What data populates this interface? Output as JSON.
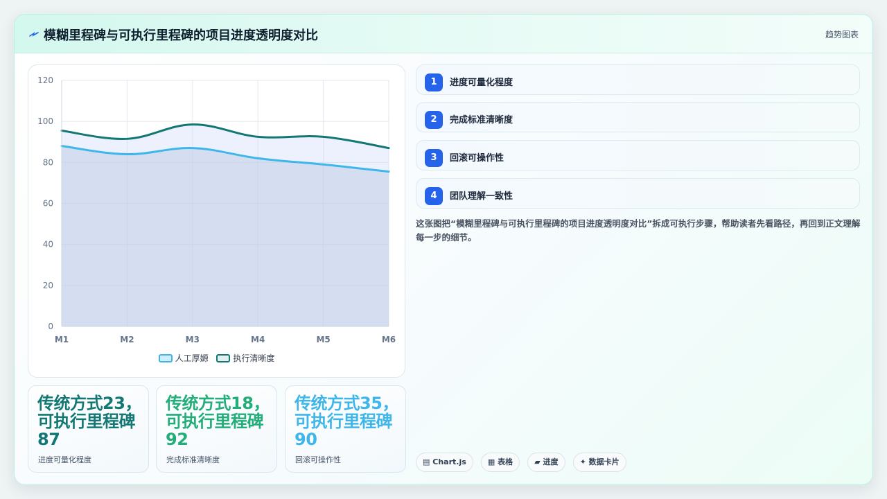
{
  "header": {
    "title": "模糊里程碑与可执行里程碑的项目进度透明度对比",
    "tag": "趋势图表"
  },
  "colors": {
    "series_a": "#3fb6ea",
    "series_b": "#137873",
    "accent_blue": "#2563eb"
  },
  "chart_data": {
    "type": "line",
    "title": "",
    "xlabel": "",
    "ylabel": "",
    "categories": [
      "M1",
      "M2",
      "M3",
      "M4",
      "M5",
      "M6"
    ],
    "ylim": [
      0,
      120
    ],
    "yticks": [
      0,
      20,
      40,
      60,
      80,
      100,
      120
    ],
    "grid": true,
    "legend_position": "bottom",
    "series": [
      {
        "name": "人工厚嫄",
        "values": [
          88,
          84,
          87,
          82,
          79,
          75.5
        ],
        "fill": true
      },
      {
        "name": "执行清晰度",
        "values": [
          95.5,
          91.5,
          98.5,
          92.5,
          92.5,
          87
        ],
        "fill": true
      }
    ]
  },
  "stats": [
    {
      "value": "传统方式23，可执行里程碑87",
      "label": "进度可量化程度",
      "color": "#137873"
    },
    {
      "value": "传统方式18，可执行里程碑92",
      "label": "完成标准清晰度",
      "color": "#22ad79"
    },
    {
      "value": "传统方式35，可执行里程碑90",
      "label": "回滚可操作性",
      "color": "#3fb6ea"
    }
  ],
  "steps": [
    {
      "num": "1",
      "label": "进度可量化程度"
    },
    {
      "num": "2",
      "label": "完成标准清晰度"
    },
    {
      "num": "3",
      "label": "回滚可操作性"
    },
    {
      "num": "4",
      "label": "团队理解一致性"
    }
  ],
  "description": "这张图把“模糊里程碑与可执行里程碑的项目进度透明度对比”拆成可执行步骤，帮助读者先看路径，再回到正文理解每一步的细节。",
  "chips": [
    {
      "icon": "▤",
      "label": "Chart.js"
    },
    {
      "icon": "▦",
      "label": "表格"
    },
    {
      "icon": "▰",
      "label": "进度"
    },
    {
      "icon": "✦",
      "label": "数据卡片"
    }
  ]
}
